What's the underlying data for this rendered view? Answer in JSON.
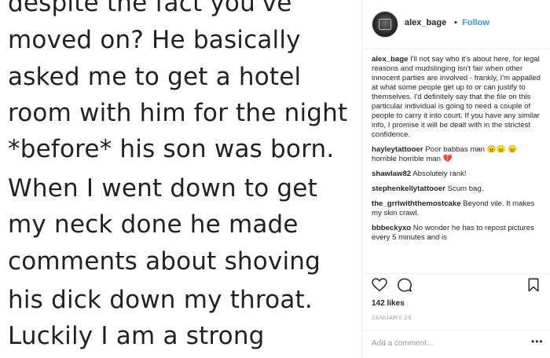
{
  "image_text": {
    "lines": [
      "despite the fact you've",
      "moved on? He basically",
      "asked me to get a hotel",
      "room with him for the night",
      "*before* his son was born.",
      "When I went down to get",
      "my neck done he made",
      "comments about shoving",
      "his dick down my throat.",
      "Luckily I am a strong"
    ]
  },
  "header": {
    "username": "alex_bage",
    "separator": "•",
    "follow_label": "Follow"
  },
  "comments": [
    {
      "user": "alex_bage",
      "text": "I'll not say who it's about here, for legal reasons and mudslinging isn't fair when other innocent parties are involved - frankly, I'm appalled at what some people get up to or can justify to themselves. I'd definitely say that the file on this particular individual is going to need a couple of people to carry it into court. If you have any similar info, I promise it will be dealt with in the strictest confidence."
    },
    {
      "user": "hayleytattooer",
      "text": "Poor babbas man 😠😠 😠 horrible horrible man 💔"
    },
    {
      "user": "shawlaw82",
      "text": "Absolutely rank!"
    },
    {
      "user": "stephenkellytattooer",
      "text": "Scum bag."
    },
    {
      "user": "the_grrlwiththemostcake",
      "text": "Beyond vile. It makes my skin crawl."
    },
    {
      "user": "bbbeckyxo",
      "text": "No wonder he has to repost pictures every 5 minutes and is"
    }
  ],
  "likes": "142 likes",
  "date": "JANUARY 26",
  "add_comment": {
    "placeholder": "Add a comment…"
  },
  "more_label": "•••",
  "icons": {
    "avatar": "avatar",
    "like": "heart-icon",
    "comment": "comment-icon",
    "save": "bookmark-icon"
  },
  "colors": {
    "accent": "#3897f0",
    "text": "#262626",
    "muted": "#999999",
    "border": "#efefef"
  }
}
